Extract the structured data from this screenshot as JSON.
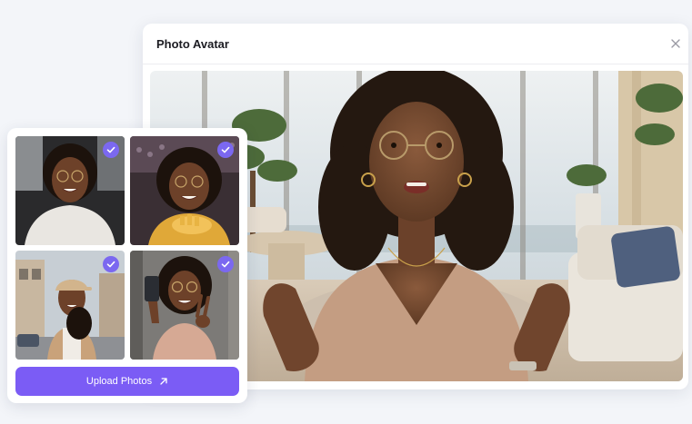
{
  "modal": {
    "title": "Photo Avatar"
  },
  "upload_card": {
    "button_label": "Upload Photos",
    "photos": [
      {
        "selected": true
      },
      {
        "selected": true
      },
      {
        "selected": true
      },
      {
        "selected": true
      }
    ]
  },
  "colors": {
    "accent": "#7b5cf5",
    "check": "#7b68f0"
  },
  "icons": [
    "close-icon",
    "check-icon",
    "arrow-up-right-icon"
  ]
}
